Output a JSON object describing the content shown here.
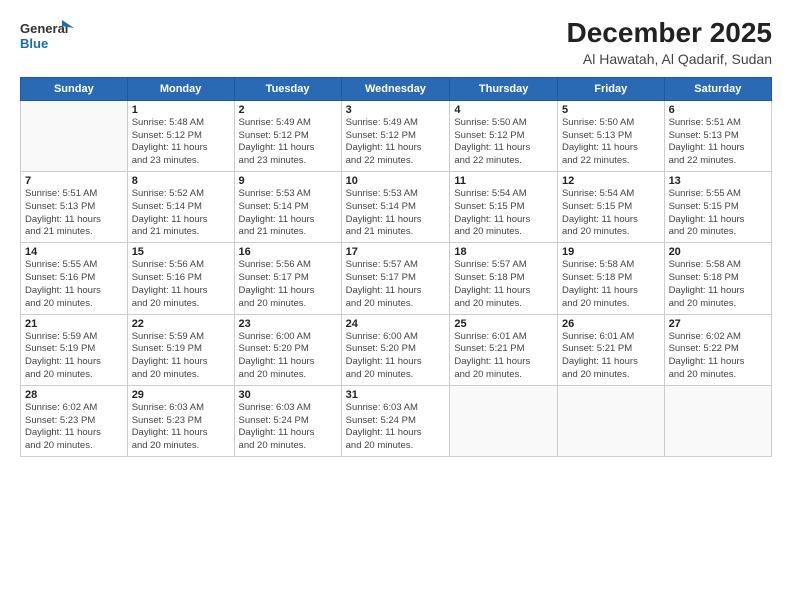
{
  "header": {
    "logo_line1": "General",
    "logo_line2": "Blue",
    "title": "December 2025",
    "subtitle": "Al Hawatah, Al Qadarif, Sudan"
  },
  "days_of_week": [
    "Sunday",
    "Monday",
    "Tuesday",
    "Wednesday",
    "Thursday",
    "Friday",
    "Saturday"
  ],
  "weeks": [
    [
      {
        "num": "",
        "detail": ""
      },
      {
        "num": "1",
        "detail": "Sunrise: 5:48 AM\nSunset: 5:12 PM\nDaylight: 11 hours\nand 23 minutes."
      },
      {
        "num": "2",
        "detail": "Sunrise: 5:49 AM\nSunset: 5:12 PM\nDaylight: 11 hours\nand 23 minutes."
      },
      {
        "num": "3",
        "detail": "Sunrise: 5:49 AM\nSunset: 5:12 PM\nDaylight: 11 hours\nand 22 minutes."
      },
      {
        "num": "4",
        "detail": "Sunrise: 5:50 AM\nSunset: 5:12 PM\nDaylight: 11 hours\nand 22 minutes."
      },
      {
        "num": "5",
        "detail": "Sunrise: 5:50 AM\nSunset: 5:13 PM\nDaylight: 11 hours\nand 22 minutes."
      },
      {
        "num": "6",
        "detail": "Sunrise: 5:51 AM\nSunset: 5:13 PM\nDaylight: 11 hours\nand 22 minutes."
      }
    ],
    [
      {
        "num": "7",
        "detail": "Sunrise: 5:51 AM\nSunset: 5:13 PM\nDaylight: 11 hours\nand 21 minutes."
      },
      {
        "num": "8",
        "detail": "Sunrise: 5:52 AM\nSunset: 5:14 PM\nDaylight: 11 hours\nand 21 minutes."
      },
      {
        "num": "9",
        "detail": "Sunrise: 5:53 AM\nSunset: 5:14 PM\nDaylight: 11 hours\nand 21 minutes."
      },
      {
        "num": "10",
        "detail": "Sunrise: 5:53 AM\nSunset: 5:14 PM\nDaylight: 11 hours\nand 21 minutes."
      },
      {
        "num": "11",
        "detail": "Sunrise: 5:54 AM\nSunset: 5:15 PM\nDaylight: 11 hours\nand 20 minutes."
      },
      {
        "num": "12",
        "detail": "Sunrise: 5:54 AM\nSunset: 5:15 PM\nDaylight: 11 hours\nand 20 minutes."
      },
      {
        "num": "13",
        "detail": "Sunrise: 5:55 AM\nSunset: 5:15 PM\nDaylight: 11 hours\nand 20 minutes."
      }
    ],
    [
      {
        "num": "14",
        "detail": "Sunrise: 5:55 AM\nSunset: 5:16 PM\nDaylight: 11 hours\nand 20 minutes."
      },
      {
        "num": "15",
        "detail": "Sunrise: 5:56 AM\nSunset: 5:16 PM\nDaylight: 11 hours\nand 20 minutes."
      },
      {
        "num": "16",
        "detail": "Sunrise: 5:56 AM\nSunset: 5:17 PM\nDaylight: 11 hours\nand 20 minutes."
      },
      {
        "num": "17",
        "detail": "Sunrise: 5:57 AM\nSunset: 5:17 PM\nDaylight: 11 hours\nand 20 minutes."
      },
      {
        "num": "18",
        "detail": "Sunrise: 5:57 AM\nSunset: 5:18 PM\nDaylight: 11 hours\nand 20 minutes."
      },
      {
        "num": "19",
        "detail": "Sunrise: 5:58 AM\nSunset: 5:18 PM\nDaylight: 11 hours\nand 20 minutes."
      },
      {
        "num": "20",
        "detail": "Sunrise: 5:58 AM\nSunset: 5:18 PM\nDaylight: 11 hours\nand 20 minutes."
      }
    ],
    [
      {
        "num": "21",
        "detail": "Sunrise: 5:59 AM\nSunset: 5:19 PM\nDaylight: 11 hours\nand 20 minutes."
      },
      {
        "num": "22",
        "detail": "Sunrise: 5:59 AM\nSunset: 5:19 PM\nDaylight: 11 hours\nand 20 minutes."
      },
      {
        "num": "23",
        "detail": "Sunrise: 6:00 AM\nSunset: 5:20 PM\nDaylight: 11 hours\nand 20 minutes."
      },
      {
        "num": "24",
        "detail": "Sunrise: 6:00 AM\nSunset: 5:20 PM\nDaylight: 11 hours\nand 20 minutes."
      },
      {
        "num": "25",
        "detail": "Sunrise: 6:01 AM\nSunset: 5:21 PM\nDaylight: 11 hours\nand 20 minutes."
      },
      {
        "num": "26",
        "detail": "Sunrise: 6:01 AM\nSunset: 5:21 PM\nDaylight: 11 hours\nand 20 minutes."
      },
      {
        "num": "27",
        "detail": "Sunrise: 6:02 AM\nSunset: 5:22 PM\nDaylight: 11 hours\nand 20 minutes."
      }
    ],
    [
      {
        "num": "28",
        "detail": "Sunrise: 6:02 AM\nSunset: 5:23 PM\nDaylight: 11 hours\nand 20 minutes."
      },
      {
        "num": "29",
        "detail": "Sunrise: 6:03 AM\nSunset: 5:23 PM\nDaylight: 11 hours\nand 20 minutes."
      },
      {
        "num": "30",
        "detail": "Sunrise: 6:03 AM\nSunset: 5:24 PM\nDaylight: 11 hours\nand 20 minutes."
      },
      {
        "num": "31",
        "detail": "Sunrise: 6:03 AM\nSunset: 5:24 PM\nDaylight: 11 hours\nand 20 minutes."
      },
      {
        "num": "",
        "detail": ""
      },
      {
        "num": "",
        "detail": ""
      },
      {
        "num": "",
        "detail": ""
      }
    ]
  ]
}
